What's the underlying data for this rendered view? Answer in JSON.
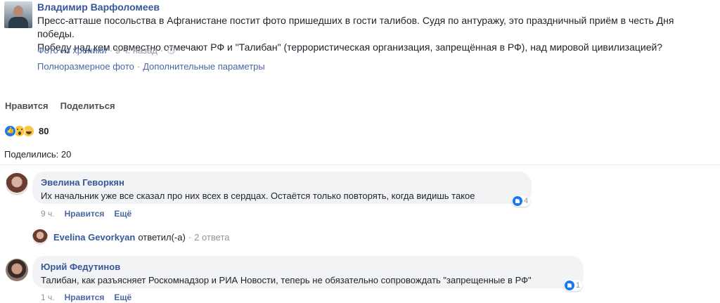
{
  "post": {
    "author": "Владимир Варфоломеев",
    "text_line1": "Пресс-атташе посольства в Афганистане постит фото пришедших в гости талибов. Судя по антуражу, это праздничный приём в честь Дня победы.",
    "text_line2": "Победу над кем совместно отмечают РФ и \"Талибан\" (террористическая организация, запрещённая в РФ), над мировой цивилизацией?",
    "source_link": "Фото из хроники",
    "time": "9 ч. назад",
    "full_photo_link": "Полноразмерное фото",
    "more_options_link": "Дополнительные параметры",
    "privacy_icon": "globe-icon"
  },
  "actions": {
    "like_label": "Нравится",
    "share_label": "Поделиться"
  },
  "reactions": {
    "icons": [
      "like-icon",
      "wow-icon",
      "haha-icon"
    ],
    "count": "80"
  },
  "shares": {
    "text": "Поделились: 20"
  },
  "comments": [
    {
      "author": "Эвелина Геворкян",
      "text": "Их начальник уже все сказал про них всех в сердцах. Остаётся только повторять, когда видишь такое",
      "reaction_count": "4",
      "time": "9 ч.",
      "like_label": "Нравится",
      "more_label": "Ещё"
    },
    {
      "author": "Юрий Федутинов",
      "text": "Талибан, как разъясняет Роскомнадзор и РИА Новости, теперь не обязательно сопровождать \"запрещенные в РФ\"",
      "reaction_count": "1",
      "time": "1 ч.",
      "like_label": "Нравится",
      "more_label": "Ещё"
    }
  ],
  "reply": {
    "name": "Evelina Gevorkyan",
    "verb": "ответил(-а)",
    "count": "2 ответа"
  },
  "colors": {
    "link": "#365899",
    "meta": "#90949c",
    "bubble": "#f2f3f5",
    "like": "#1877f2"
  }
}
